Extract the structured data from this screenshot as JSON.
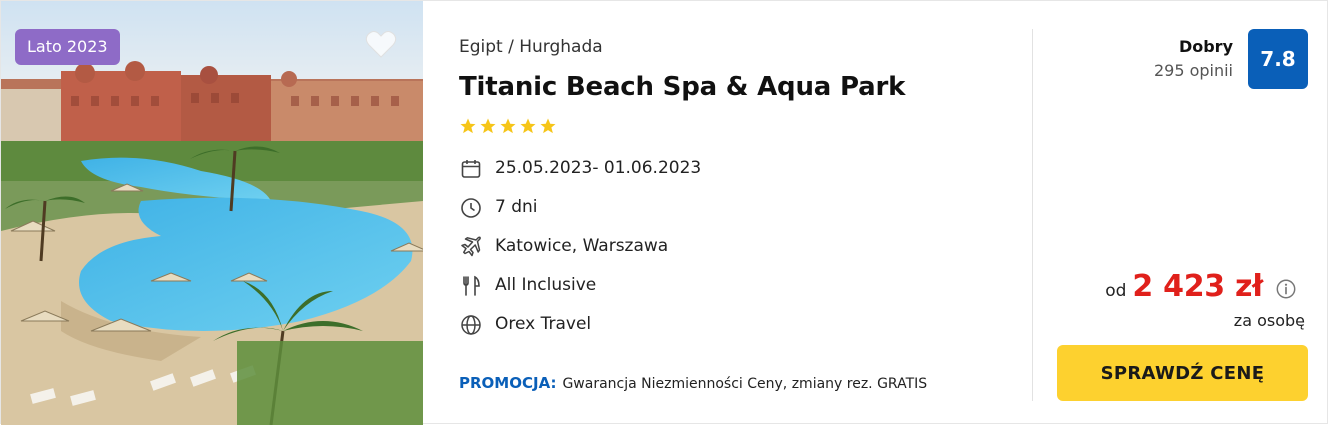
{
  "offer": {
    "season_badge": "Lato 2023",
    "favorite_icon": "heart-icon",
    "location": "Egipt / Hurghada",
    "hotel_name": "Titanic Beach Spa & Aqua Park",
    "star_rating": 5,
    "details": [
      {
        "icon": "calendar-icon",
        "text": "25.05.2023- 01.06.2023"
      },
      {
        "icon": "clock-icon",
        "text": "7 dni"
      },
      {
        "icon": "plane-icon",
        "text": "Katowice, Warszawa"
      },
      {
        "icon": "fork-knife-icon",
        "text": "All Inclusive"
      },
      {
        "icon": "globe-icon",
        "text": "Orex Travel"
      }
    ],
    "promo_label": "PROMOCJA:",
    "promo_text": "Gwarancja Niezmienności Ceny, zmiany rez. GRATIS",
    "rating_label": "Dobry",
    "review_count": "295 opinii",
    "rating_score": "7.8",
    "price_prefix": "od",
    "price": "2 423 zł",
    "price_info_icon": "info-icon",
    "per_person": "za osobę",
    "cta_label": "SPRAWDŹ CENĘ"
  },
  "colors": {
    "badge": "#8e6bc7",
    "rating_bg": "#0a5fb8",
    "promo": "#0a5fb8",
    "price": "#e0201b",
    "cta_bg": "#fdd12f",
    "stars": "#f6c518"
  }
}
